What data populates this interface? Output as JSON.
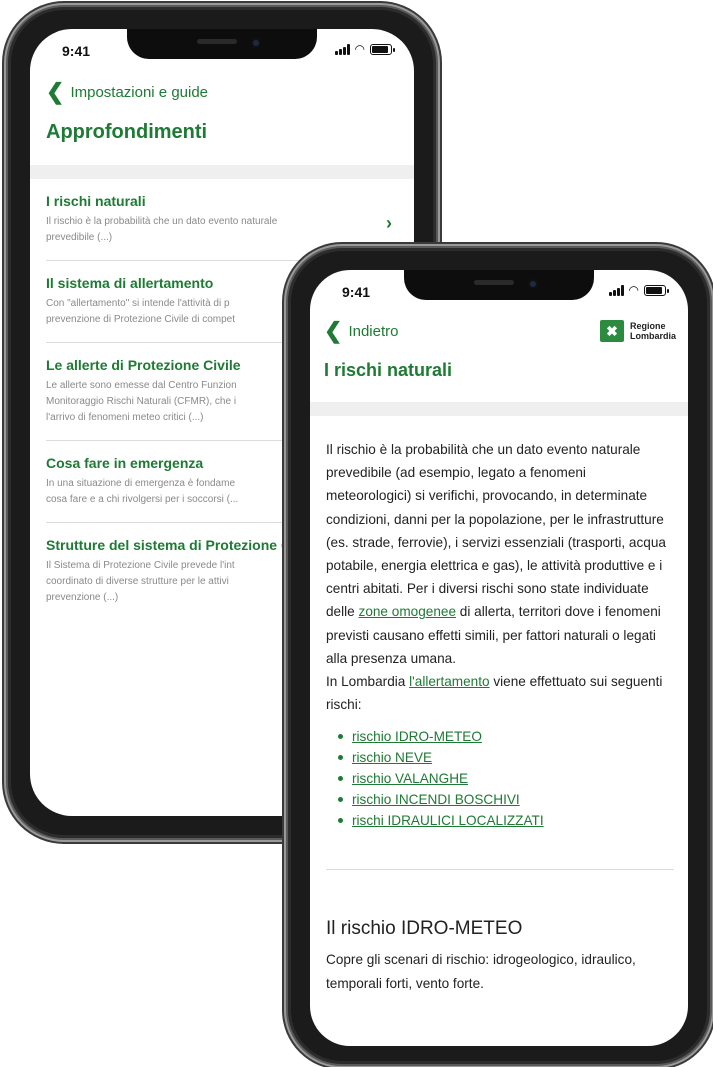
{
  "status_bar": {
    "time": "9:41"
  },
  "back_screen": {
    "nav_back_label": "Impostazioni e guide",
    "title": "Approfondimenti",
    "items": [
      {
        "title": "I rischi naturali",
        "desc_lines": [
          "Il rischio è la probabilità che un dato evento naturale",
          "prevedibile (...)"
        ]
      },
      {
        "title": "Il sistema di allertamento",
        "desc_lines": [
          "Con \"allertamento\" si intende l'attività di p",
          "prevenzione di Protezione Civile di compet"
        ]
      },
      {
        "title": "Le allerte di Protezione Civile",
        "desc_lines": [
          "Le allerte sono emesse dal Centro Funzion",
          "Monitoraggio Rischi Naturali (CFMR), che i",
          "l'arrivo di fenomeni meteo critici (...)"
        ]
      },
      {
        "title": "Cosa fare in emergenza",
        "desc_lines": [
          "In una situazione di emergenza è fondame",
          "cosa fare e a chi rivolgersi per i soccorsi (..."
        ]
      },
      {
        "title": "Strutture del sistema di Protezione C",
        "desc_lines": [
          "Il Sistema di Protezione Civile prevede l'int",
          "coordinato di diverse strutture per le attivi",
          "prevenzione (...)"
        ]
      }
    ]
  },
  "front_screen": {
    "nav_back_label": "Indietro",
    "logo": {
      "line1": "Regione",
      "line2": "Lombardia"
    },
    "title": "I rischi naturali",
    "intro_part1": "Il rischio è la probabilità che un dato evento naturale prevedibile (ad esempio, legato a fenomeni meteorologici) si verifichi, provocando, in determinate condizioni, danni per la popolazione, per le infrastrutture (es. strade, ferrovie), i servizi essenziali (trasporti, acqua potabile, energia elettrica e gas), le attività produttive e i centri abitati. Per i diversi rischi sono state individuate delle",
    "intro_link1": "zone omogenee",
    "intro_part2": "di allerta, territori dove i fenomeni previsti causano effetti simili, per fattori naturali o legati alla presenza umana.",
    "intro2_part1": "In Lombardia",
    "intro2_link": "l'allertamento",
    "intro2_part2": "viene effettuato sui seguenti rischi:",
    "risks": [
      "rischio IDRO-METEO",
      "rischio NEVE",
      "rischio VALANGHE",
      "rischio INCENDI BOSCHIVI",
      "rischi IDRAULICI LOCALIZZATI"
    ],
    "section_heading": "Il rischio IDRO-METEO",
    "section_text": "Copre gli scenari di rischio: idrogeologico, idraulico, temporali forti, vento forte."
  }
}
